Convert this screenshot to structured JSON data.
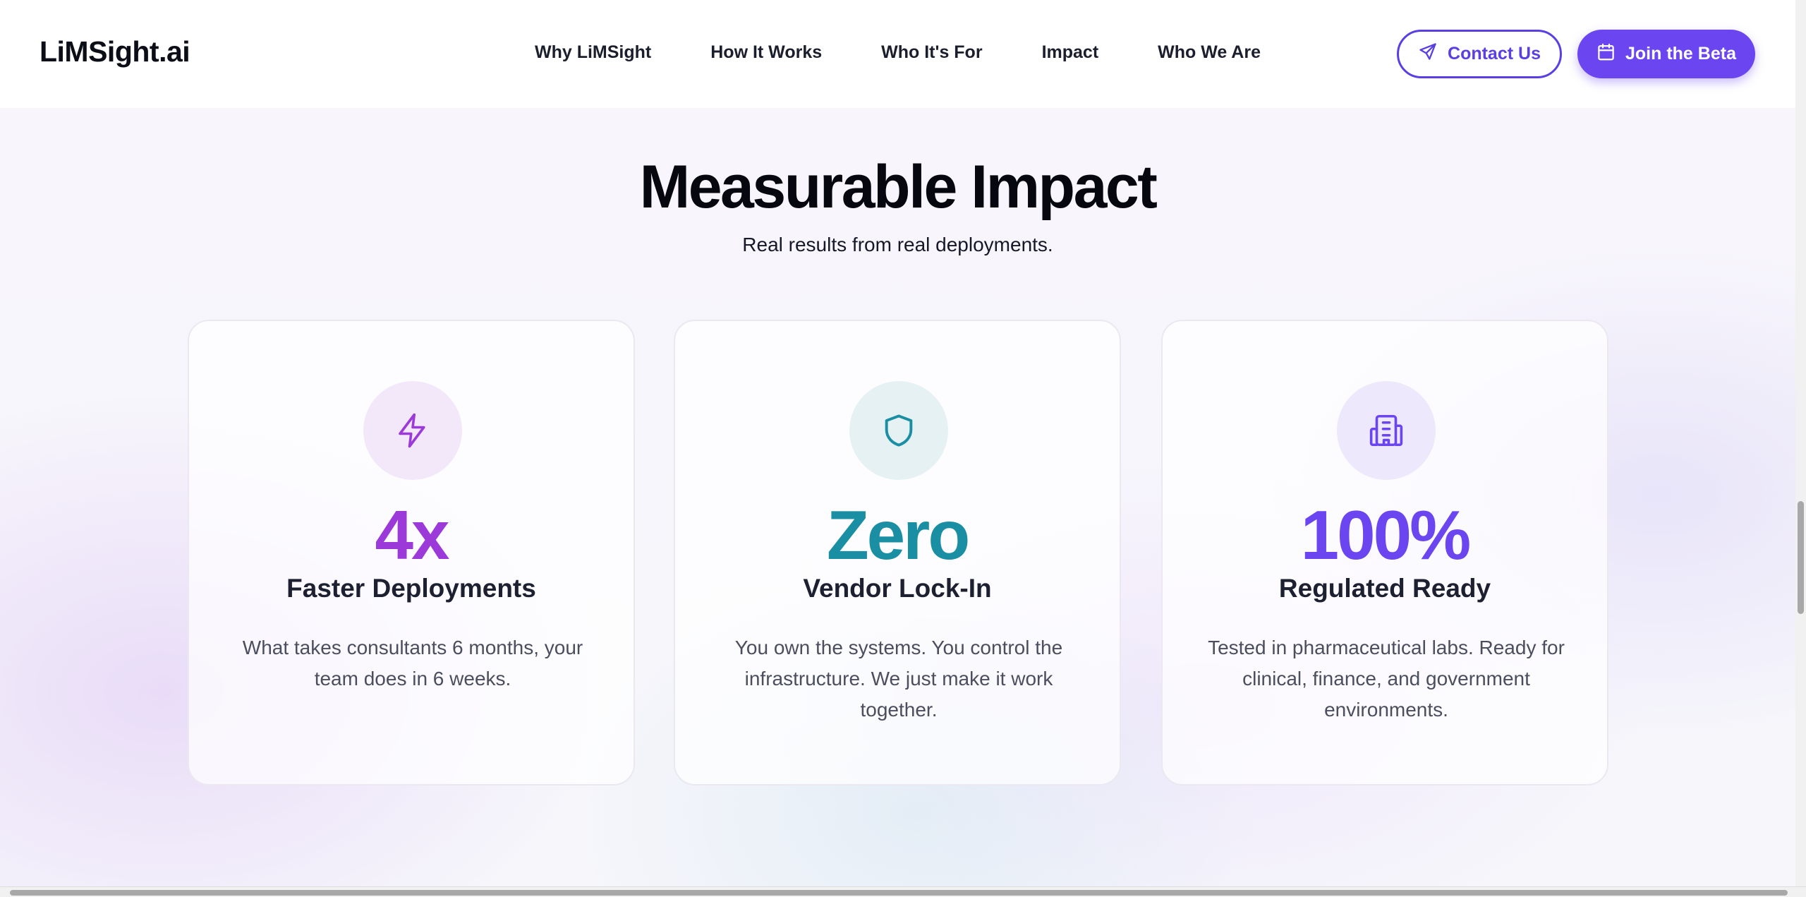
{
  "header": {
    "logo": "LiMSight.ai",
    "nav": [
      "Why LiMSight",
      "How It Works",
      "Who It's For",
      "Impact",
      "Who We Are"
    ],
    "contact_label": "Contact Us",
    "contact_icon": "send-icon",
    "beta_label": "Join the Beta",
    "beta_icon": "calendar-icon"
  },
  "section": {
    "title": "Measurable Impact",
    "subtitle": "Real results from real deployments."
  },
  "cards": [
    {
      "stat": "4x",
      "label": "Faster Deployments",
      "description": "What takes consultants 6 months, your team does in 6 weeks.",
      "icon": "lightning-icon",
      "accent": "#9b3ad8",
      "icon_bg": "#f3e8fa"
    },
    {
      "stat": "Zero",
      "label": "Vendor Lock-In",
      "description": "You own the systems. You control the infrastructure. We just make it work together.",
      "icon": "shield-icon",
      "accent": "#1a8ea3",
      "icon_bg": "#e6f1f4"
    },
    {
      "stat": "100%",
      "label": "Regulated Ready",
      "description": "Tested in pharmaceutical labs. Ready for clinical, finance, and government environments.",
      "icon": "building-icon",
      "accent": "#6a45f0",
      "icon_bg": "#ede8fb"
    }
  ]
}
